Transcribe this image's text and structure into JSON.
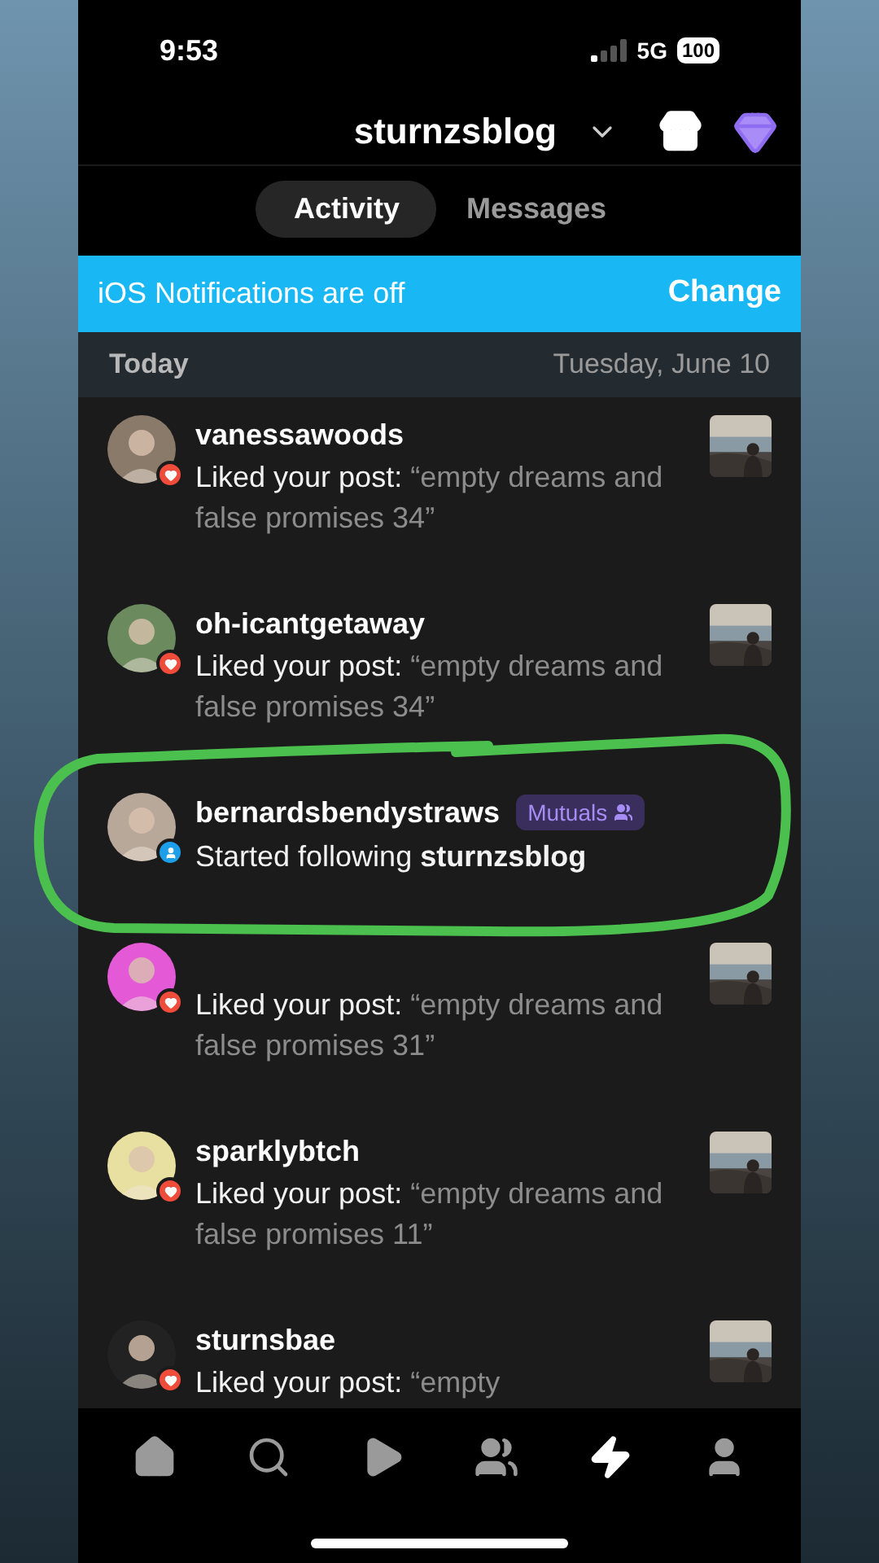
{
  "status_bar": {
    "time": "9:53",
    "network": "5G",
    "battery": "100"
  },
  "header": {
    "blog": "sturnzsblog"
  },
  "tabs": [
    {
      "label": "Activity",
      "selected": true
    },
    {
      "label": "Messages",
      "selected": false
    }
  ],
  "banner": {
    "text": "iOS Notifications are off",
    "action": "Change"
  },
  "section": {
    "title": "Today",
    "date": "Tuesday, June 10"
  },
  "notifications": [
    {
      "kind": "like",
      "name": "vanessawoods",
      "action": "Liked your post:",
      "quote": "“empty dreams and false promises 34”"
    },
    {
      "kind": "like",
      "name": "oh-icantgetaway",
      "action": "Liked your post:",
      "quote": "“empty dreams and false promises 34”"
    },
    {
      "kind": "follow",
      "name": "bernardsbendystraws",
      "badge": "Mutuals",
      "action": "Started following",
      "target": "sturnzsblog"
    },
    {
      "kind": "like",
      "action": "Liked your post:",
      "quote": "“empty dreams and false promises 31”"
    },
    {
      "kind": "like",
      "name": "sparklybtch",
      "action": "Liked your post:",
      "quote": "“empty dreams and false promises 11”"
    },
    {
      "kind": "like",
      "name": "sturnsbae",
      "action": "Liked your post:",
      "quote": "“empty"
    }
  ],
  "nav": [
    {
      "selected": false
    },
    {
      "selected": false
    },
    {
      "selected": false
    },
    {
      "selected": false
    },
    {
      "selected": true
    },
    {
      "selected": false
    }
  ]
}
